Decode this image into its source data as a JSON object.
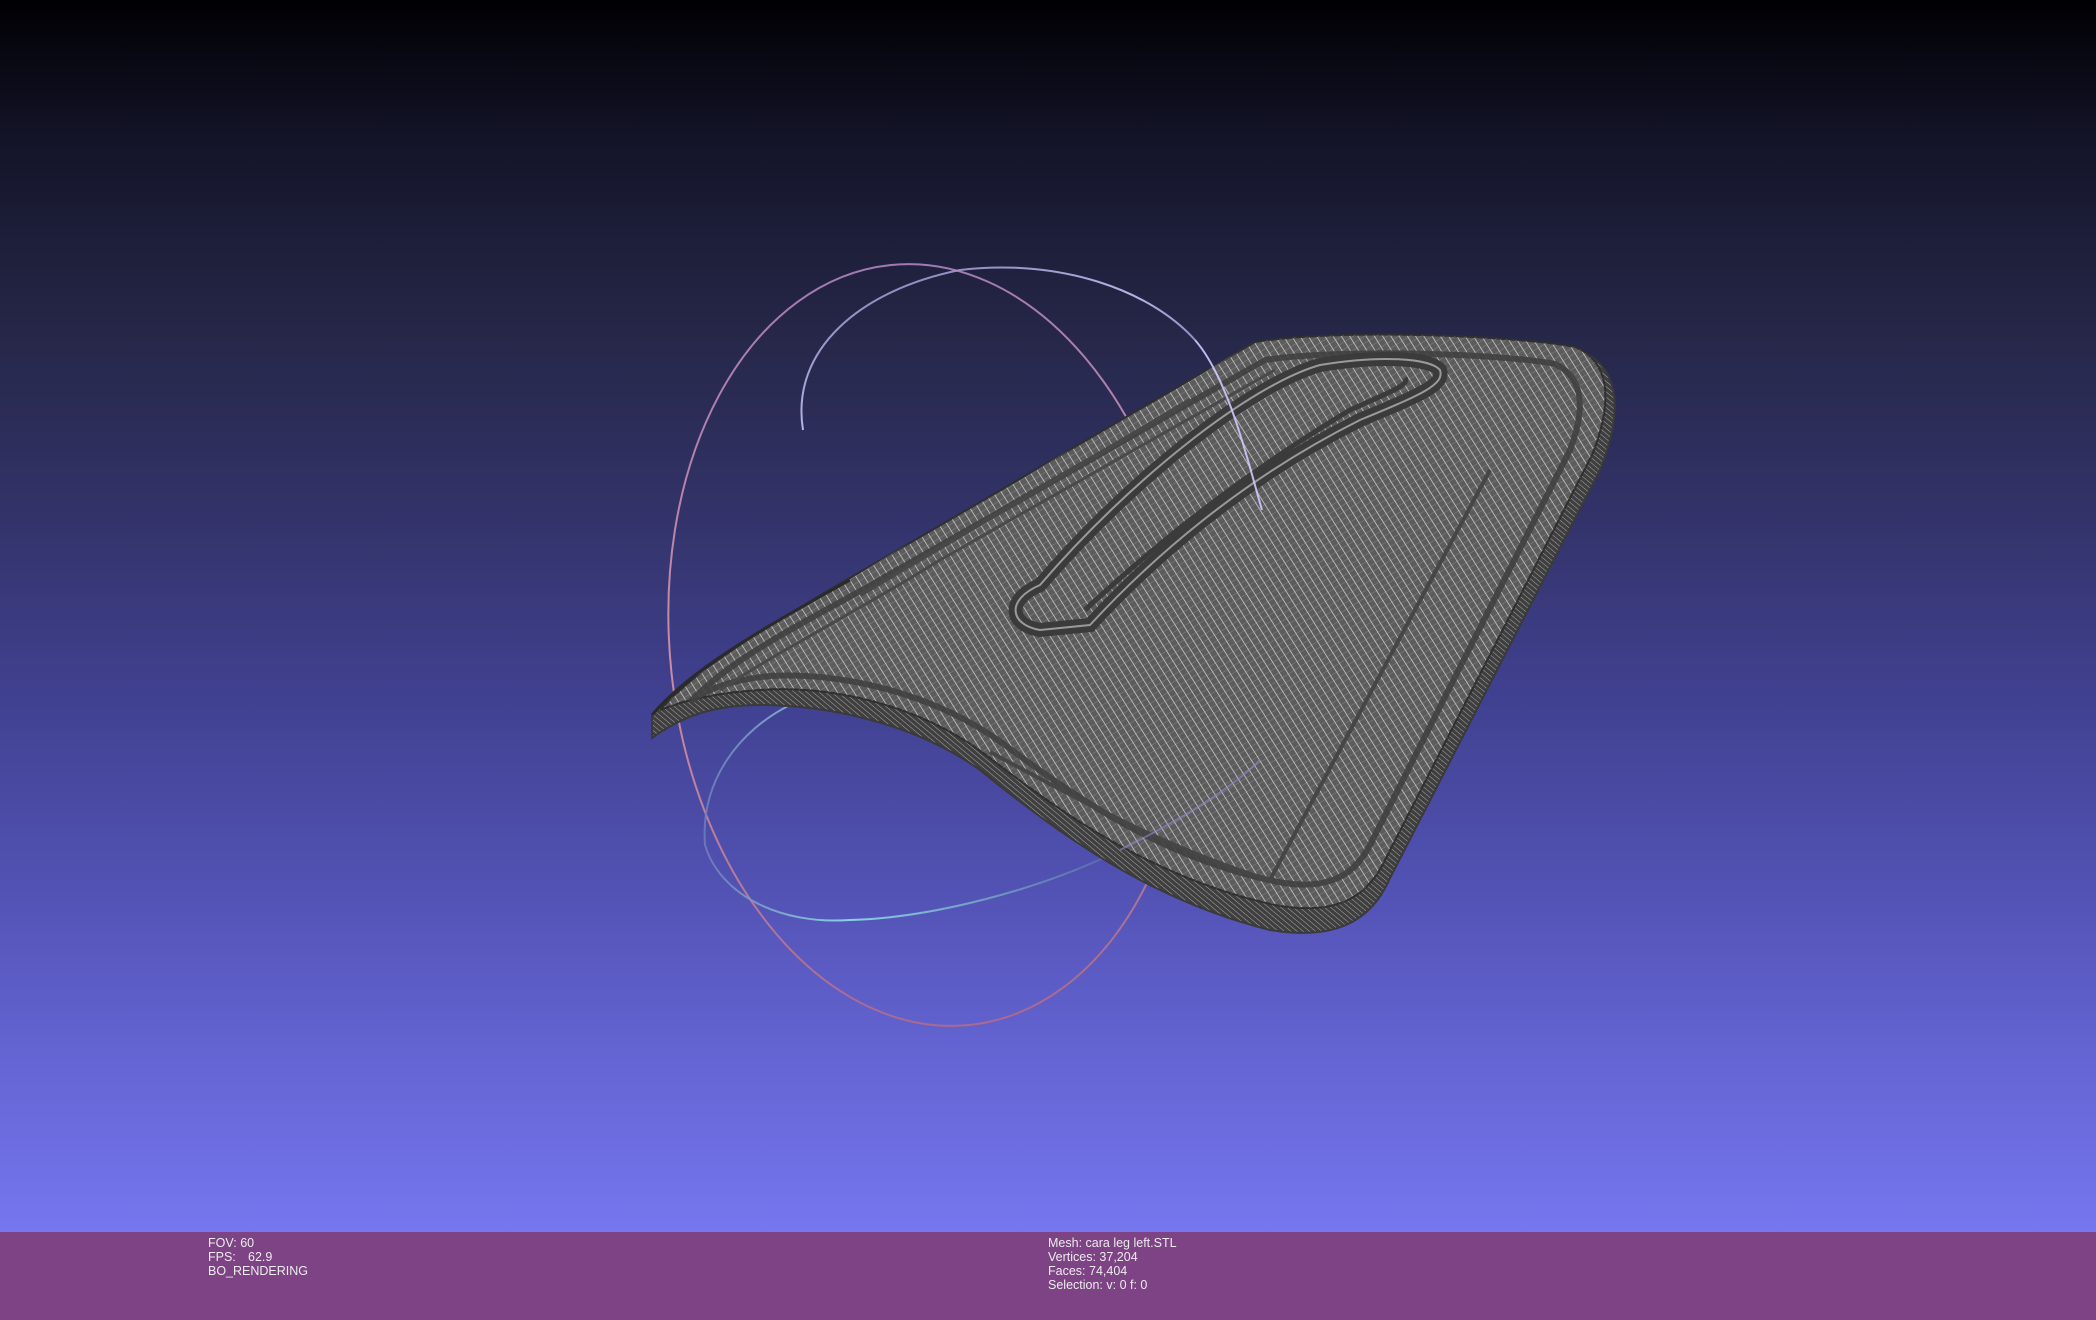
{
  "viewport": {
    "background_top": "#000003",
    "background_bottom": "#7676ef",
    "mesh_color": "#5a5a5a",
    "wire_color": "#cfcfcf",
    "trackball": {
      "x_ring_color": "#d98a9a",
      "y_ring_color": "#8fe0e6",
      "z_ring_color": "#a8a0e8"
    }
  },
  "info_bar": {
    "background": "#7d4384",
    "left": {
      "fov_label": "FOV:",
      "fov_value": "60",
      "fps_label": "FPS:",
      "fps_value": "62.9",
      "render_mode": "BO_RENDERING"
    },
    "center": {
      "mesh_label": "Mesh:",
      "mesh_name": "cara leg left.STL",
      "vertices_label": "Vertices:",
      "vertices_value": "37,204",
      "faces_label": "Faces:",
      "faces_value": "74,404",
      "selection_label": "Selection:",
      "selection_value": "v: 0 f: 0"
    }
  }
}
